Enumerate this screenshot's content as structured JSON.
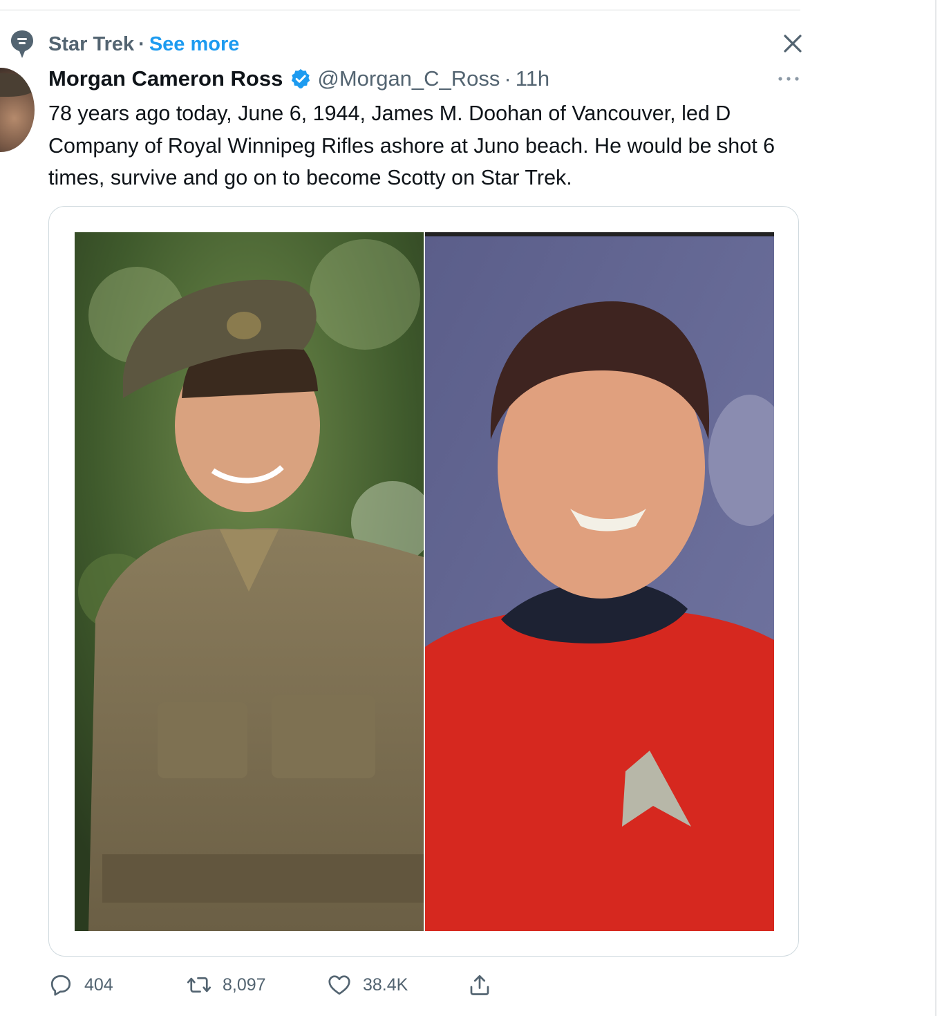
{
  "context": {
    "topic": "Star Trek",
    "separator": "·",
    "see_more": "See more"
  },
  "tweet": {
    "author_name": "Morgan Cameron Ross",
    "handle": "@Morgan_C_Ross",
    "separator": "·",
    "time": "11h",
    "text": "78 years ago today, June 6, 1944, James M. Doohan of Vancouver, led D Company of Royal Winnipeg Rifles ashore at Juno beach. He would be shot 6 times, survive and go on to become Scotty on Star Trek."
  },
  "actions": {
    "replies": "404",
    "retweets": "8,097",
    "likes": "38.4K"
  },
  "icons": {
    "topic": "topic-pin-icon",
    "close": "close-icon",
    "verified": "verified-badge-icon",
    "more": "more-icon",
    "reply": "reply-icon",
    "retweet": "retweet-icon",
    "like": "like-icon",
    "share": "share-icon"
  },
  "colors": {
    "accent": "#1d9bf0",
    "secondary_text": "#536471",
    "primary_text": "#0f1419",
    "border": "#cfd9de"
  }
}
